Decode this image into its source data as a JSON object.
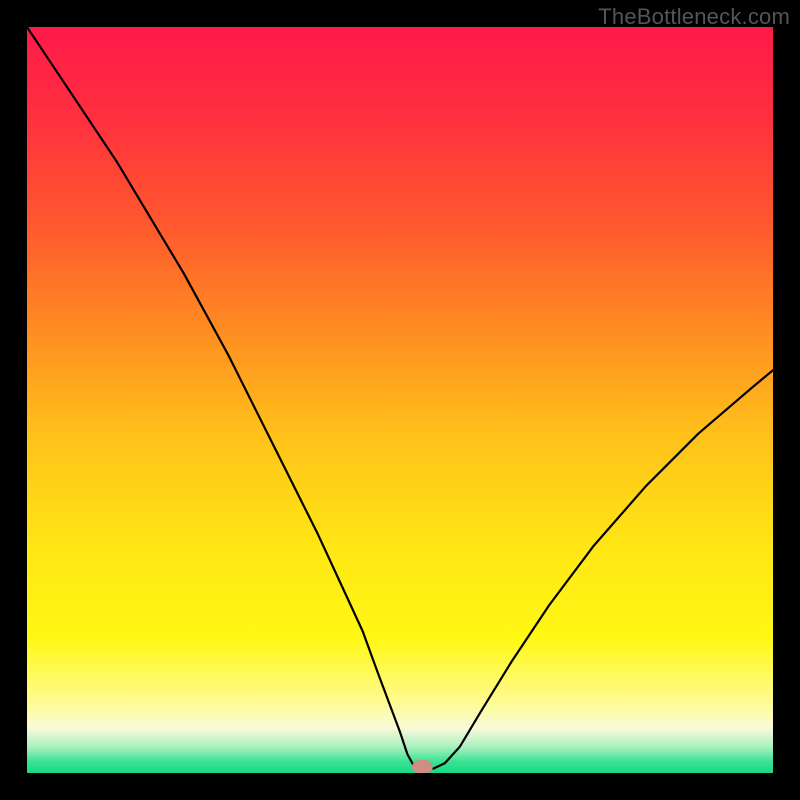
{
  "watermark": "TheBottleneck.com",
  "colors": {
    "frame": "#000000",
    "curve": "#000000",
    "marker": "#cf8e84",
    "gradient_stops": [
      {
        "offset": 0.0,
        "color": "#ff1a4a"
      },
      {
        "offset": 0.12,
        "color": "#ff2f3f"
      },
      {
        "offset": 0.27,
        "color": "#ff5a2d"
      },
      {
        "offset": 0.4,
        "color": "#ff8a22"
      },
      {
        "offset": 0.55,
        "color": "#ffc21a"
      },
      {
        "offset": 0.7,
        "color": "#ffe714"
      },
      {
        "offset": 0.82,
        "color": "#fff814"
      },
      {
        "offset": 0.9,
        "color": "#fffb8a"
      },
      {
        "offset": 0.94,
        "color": "#f8fbd8"
      },
      {
        "offset": 0.965,
        "color": "#aaf0c0"
      },
      {
        "offset": 0.985,
        "color": "#38e293"
      },
      {
        "offset": 1.0,
        "color": "#18d884"
      }
    ]
  },
  "chart_data": {
    "type": "line",
    "title": "",
    "xlabel": "",
    "ylabel": "",
    "xlim": [
      0,
      100
    ],
    "ylim": [
      0,
      100
    ],
    "grid": false,
    "legend": false,
    "series": [
      {
        "name": "bottleneck-curve",
        "x": [
          0,
          3,
          6,
          9,
          12,
          15,
          18,
          21,
          24,
          27,
          30,
          33,
          36,
          39,
          42,
          45,
          47,
          48.5,
          50,
          51,
          52,
          53,
          54.5,
          56,
          58,
          61,
          65,
          70,
          76,
          83,
          90,
          97,
          100
        ],
        "y": [
          100,
          95.5,
          91,
          86.5,
          82,
          77,
          72,
          67,
          61.5,
          56,
          50,
          44,
          38,
          32,
          25.5,
          19,
          13.5,
          9.5,
          5.5,
          2.5,
          0.7,
          0.6,
          0.6,
          1.3,
          3.5,
          8.5,
          15,
          22.5,
          30.5,
          38.5,
          45.5,
          51.5,
          54
        ]
      }
    ],
    "marker": {
      "x": 53,
      "y": 0.8,
      "rx": 1.4,
      "ry": 1.0
    }
  }
}
